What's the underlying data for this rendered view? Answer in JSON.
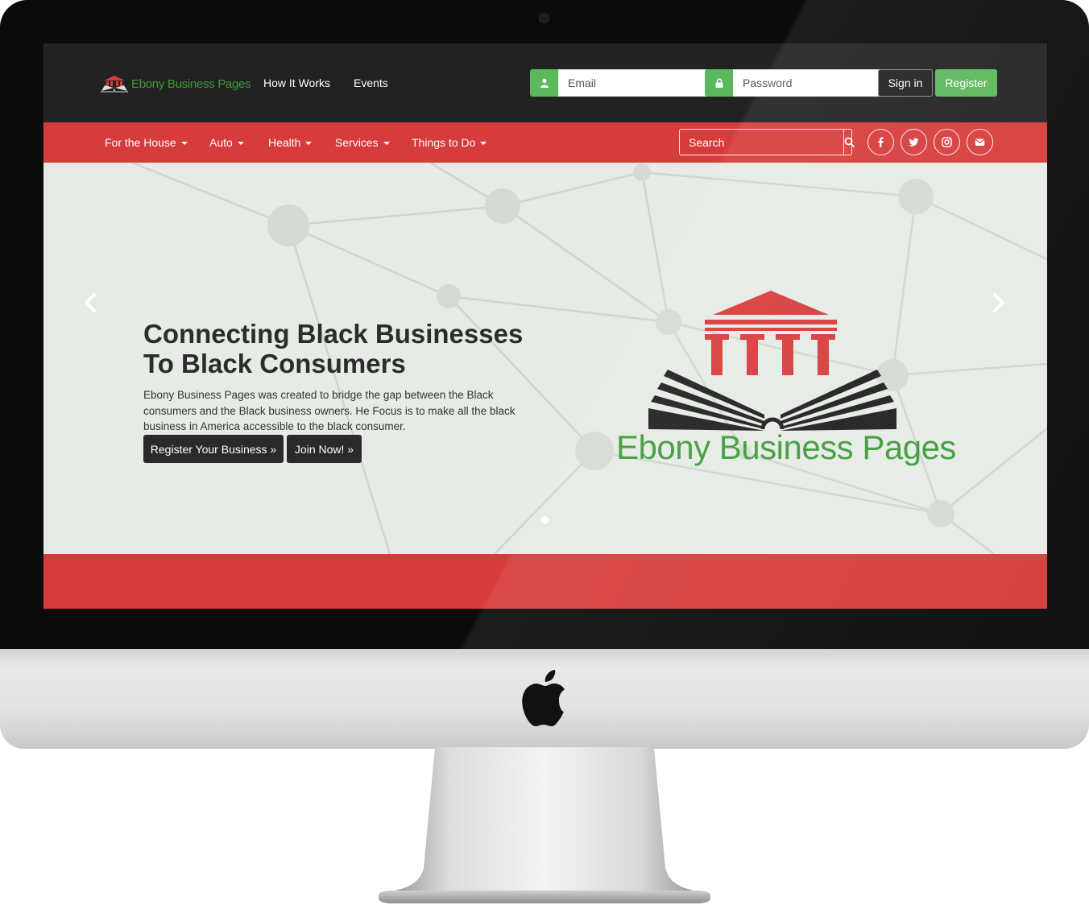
{
  "brand": {
    "name": "Ebony Business Pages",
    "colors": {
      "green": "#5cb85c",
      "logo_green": "#3f9b3a",
      "red": "#d73c3c",
      "dark": "#222222",
      "hero_bg": "#e6ebe5"
    }
  },
  "header": {
    "links": [
      {
        "label": "How It Works"
      },
      {
        "label": "Events"
      }
    ],
    "login": {
      "email_placeholder": "Email",
      "password_placeholder": "Password",
      "email_icon": "user-icon",
      "password_icon": "lock-icon",
      "signin_label": "Sign in",
      "register_label": "Register"
    }
  },
  "navbar": {
    "items": [
      {
        "label": "For the House"
      },
      {
        "label": "Auto"
      },
      {
        "label": "Health"
      },
      {
        "label": "Services"
      },
      {
        "label": "Things to Do"
      }
    ],
    "search": {
      "placeholder": "Search",
      "icon": "search-icon"
    },
    "social": [
      "facebook-icon",
      "twitter-icon",
      "instagram-icon",
      "envelope-icon"
    ]
  },
  "hero": {
    "title_line1": "Connecting Black Businesses",
    "title_line2": "To Black Consumers",
    "description": "Ebony Business Pages was created to bridge the gap between the Black consumers and the Black business owners. He Focus is to make all the black business in America accessible to the black consumer.",
    "primary_cta": "Register Your Business »",
    "secondary_cta": "Join Now! »",
    "logo_text": "Ebony Business Pages",
    "slide_count": 1,
    "active_slide": 1
  }
}
